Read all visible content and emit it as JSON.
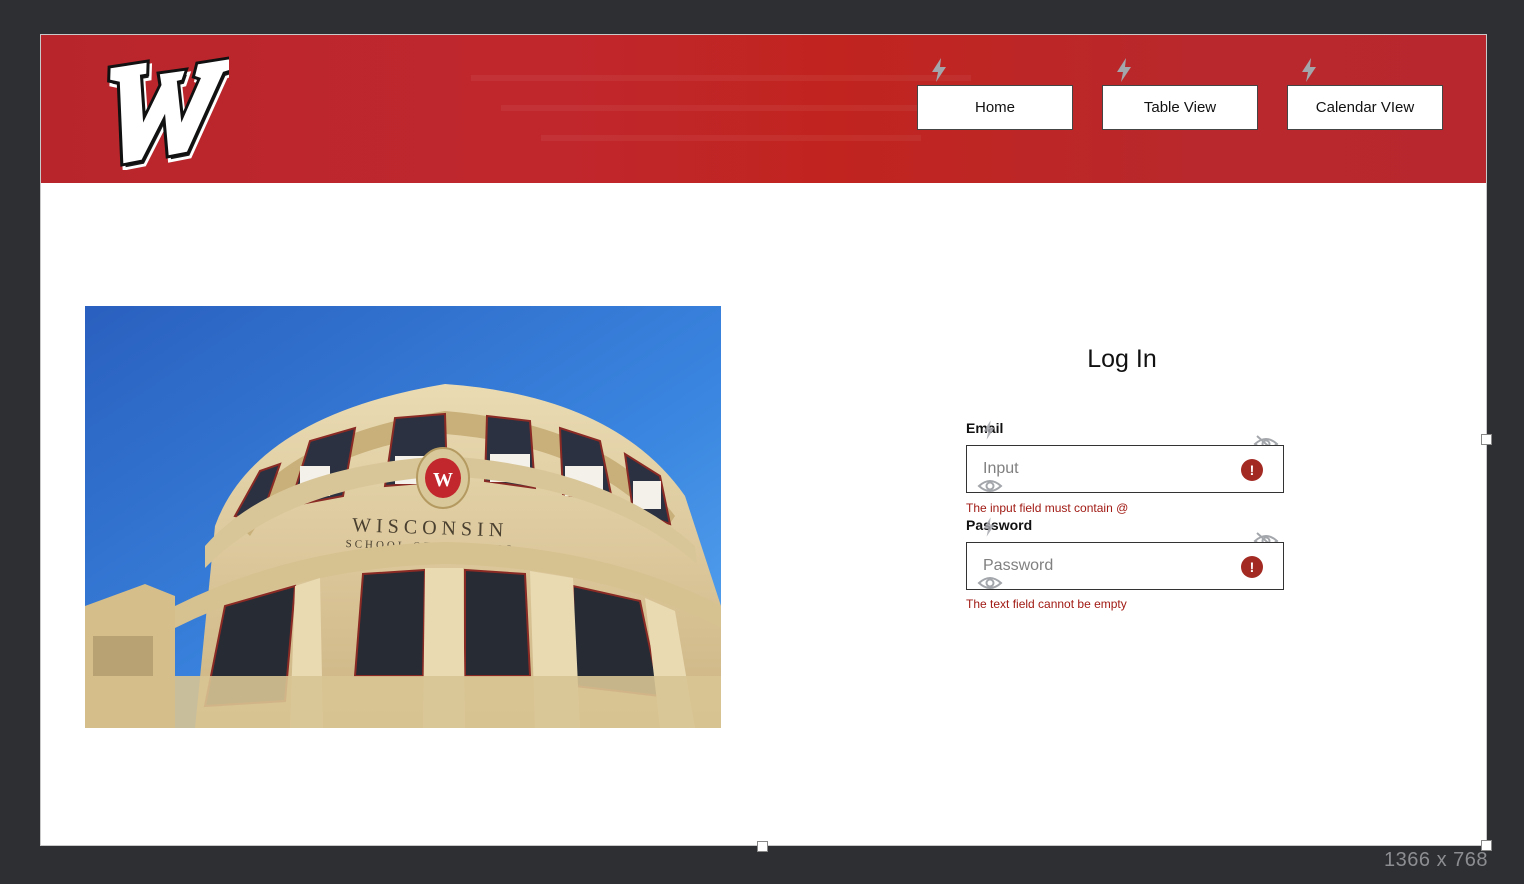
{
  "nav": {
    "items": [
      {
        "label": "Home"
      },
      {
        "label": "Table View"
      },
      {
        "label": "Calendar VIew"
      }
    ]
  },
  "logo": {
    "letter": "W"
  },
  "photo": {
    "crest_letter": "W",
    "sign_line1": "WISCONSIN",
    "sign_line2": "SCHOOL OF BUSINESS"
  },
  "login": {
    "title": "Log In",
    "email": {
      "label": "Email",
      "placeholder": "Input",
      "error": "The input field must contain @"
    },
    "password": {
      "label": "Password",
      "placeholder": "Password",
      "error": "The text field cannot be empty"
    },
    "error_glyph": "!"
  },
  "canvas": {
    "size_label": "1366 x 768"
  },
  "colors": {
    "header": "#c0272d",
    "error": "#a32a23",
    "sky": "#2f6fc9",
    "building": "#e2cfa2"
  },
  "icons": [
    "lightning-icon",
    "eye-off-icon",
    "eye-icon",
    "error-icon",
    "w-logo"
  ]
}
